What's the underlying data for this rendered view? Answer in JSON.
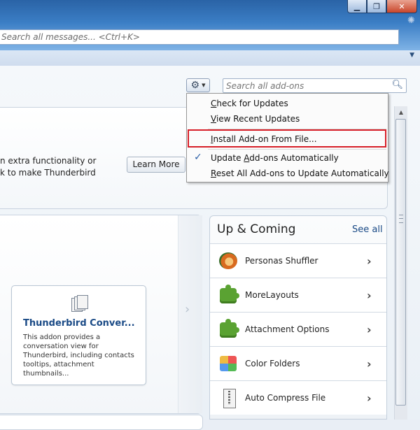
{
  "window": {
    "minimize_label": "▁",
    "maximize_label": "❐",
    "close_label": "✕",
    "message_search_placeholder": "Search all messages... <Ctrl+K>"
  },
  "addons": {
    "search_placeholder": "Search all add-ons",
    "upper_text_line1": "n extra functionality or",
    "upper_text_line2": "k to make Thunderbird",
    "learn_more": "Learn More"
  },
  "menu": {
    "items": [
      {
        "pre": "",
        "ul": "C",
        "post": "heck for Updates"
      },
      {
        "pre": "",
        "ul": "V",
        "post": "iew Recent Updates"
      },
      {
        "pre": "",
        "ul": "I",
        "post": "nstall Add-on From File..."
      },
      {
        "pre": "Update ",
        "ul": "A",
        "post": "dd-ons Automatically"
      },
      {
        "pre": "",
        "ul": "R",
        "post": "eset All Add-ons to Update Automatically"
      }
    ],
    "check_mark": "✓"
  },
  "featured": {
    "title": "Thunderbird Conver...",
    "description": "This addon provides a conversation view for Thunderbird, including contacts tooltips, attachment thumbnails..."
  },
  "upcoming": {
    "title": "Up & Coming",
    "see_all": "See all",
    "items": [
      {
        "name": "Personas Shuffler",
        "icon": "fox-icon"
      },
      {
        "name": "MoreLayouts",
        "icon": "puzzle-icon"
      },
      {
        "name": "Attachment Options",
        "icon": "puzzle-icon"
      },
      {
        "name": "Color Folders",
        "icon": "color-folder-icon"
      },
      {
        "name": "Auto Compress File",
        "icon": "zip-file-icon"
      }
    ]
  }
}
